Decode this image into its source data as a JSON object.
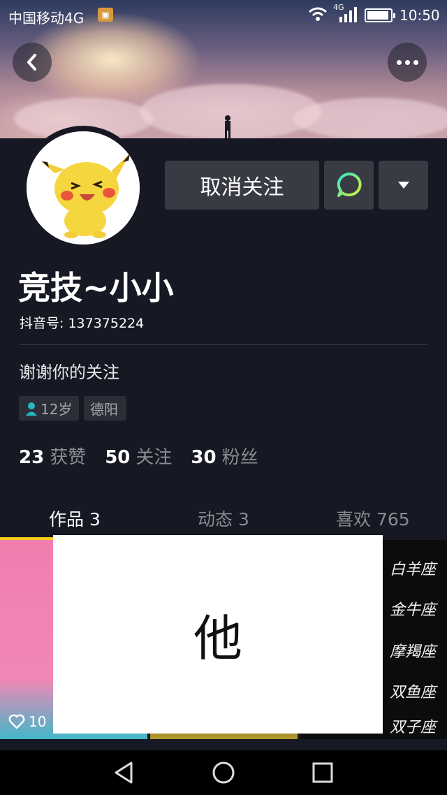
{
  "status_bar": {
    "carrier": "中国移动4G",
    "network": "4G",
    "time": "10:50"
  },
  "profile": {
    "nickname": "竞技~小小",
    "douyin_id": "抖音号: 137375224",
    "bio": "谢谢你的关注",
    "tags": {
      "age": "12岁",
      "city": "德阳"
    }
  },
  "actions": {
    "unfollow_label": "取消关注"
  },
  "stats": [
    {
      "count": "23",
      "label": "获赞"
    },
    {
      "count": "50",
      "label": "关注"
    },
    {
      "count": "30",
      "label": "粉丝"
    }
  ],
  "tabs": {
    "works": "作品 3",
    "dynamics": "动态 3",
    "likes": "喜欢 765"
  },
  "videos": {
    "first_like_count": "10",
    "zodiac_items": [
      "白羊座",
      "金牛座",
      "摩羯座",
      "双鱼座",
      "双子座"
    ]
  },
  "overlay": {
    "text": "他"
  },
  "colors": {
    "background": "#161823",
    "tab_indicator": "#face15",
    "button": "#393b44"
  }
}
